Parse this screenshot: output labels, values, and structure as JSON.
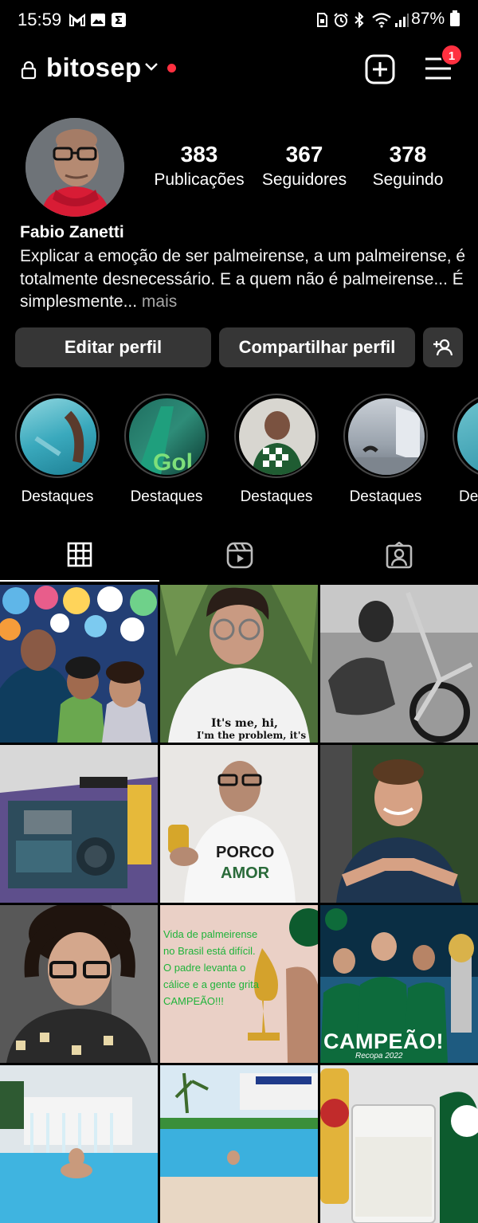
{
  "status_bar": {
    "time": "15:59",
    "battery": "87%",
    "left_icons": [
      "gmail-icon",
      "gallery-icon",
      "sigma-app-icon"
    ],
    "right_icons": [
      "sim-icon",
      "alarm-icon",
      "bluetooth-icon",
      "wifi-icon",
      "signal-icon",
      "battery-icon"
    ]
  },
  "header": {
    "username": "bitosep",
    "notification_count": "1"
  },
  "profile": {
    "stats": [
      {
        "value": "383",
        "label": "Publicações"
      },
      {
        "value": "367",
        "label": "Seguidores"
      },
      {
        "value": "378",
        "label": "Seguindo"
      }
    ],
    "full_name": "Fabio Zanetti",
    "bio": "Explicar a emoção de ser palmeirense, a um palmeirense, é totalmente desnecessário. E a quem não é palmeirense... É simplesmente",
    "bio_ellipsis": "...",
    "bio_more": " mais"
  },
  "buttons": {
    "edit": "Editar perfil",
    "share": "Compartilhar perfil"
  },
  "highlights": [
    {
      "label": "Destaques"
    },
    {
      "label": "Destaques"
    },
    {
      "label": "Destaques"
    },
    {
      "label": "Destaques"
    },
    {
      "label": "De"
    }
  ],
  "grid_texts": {
    "post2_shirt": "It's me, hi,",
    "post2_shirt2": "I'm the problem, it's me",
    "post5_shirt": "PORCO",
    "post5_shirt2": "AMOR",
    "post8_text": "Vida de palmeirense no Brasil está difícil. O padre levanta o cálice e a gente grita CAMPEÃO!!!",
    "post9_title": "CAMPEÃO!",
    "post9_sub": "Recopa 2022"
  },
  "colors": {
    "background": "#000000",
    "button": "#363636",
    "accent_red": "#ff3040",
    "secondary_text": "#a8a8a8"
  }
}
